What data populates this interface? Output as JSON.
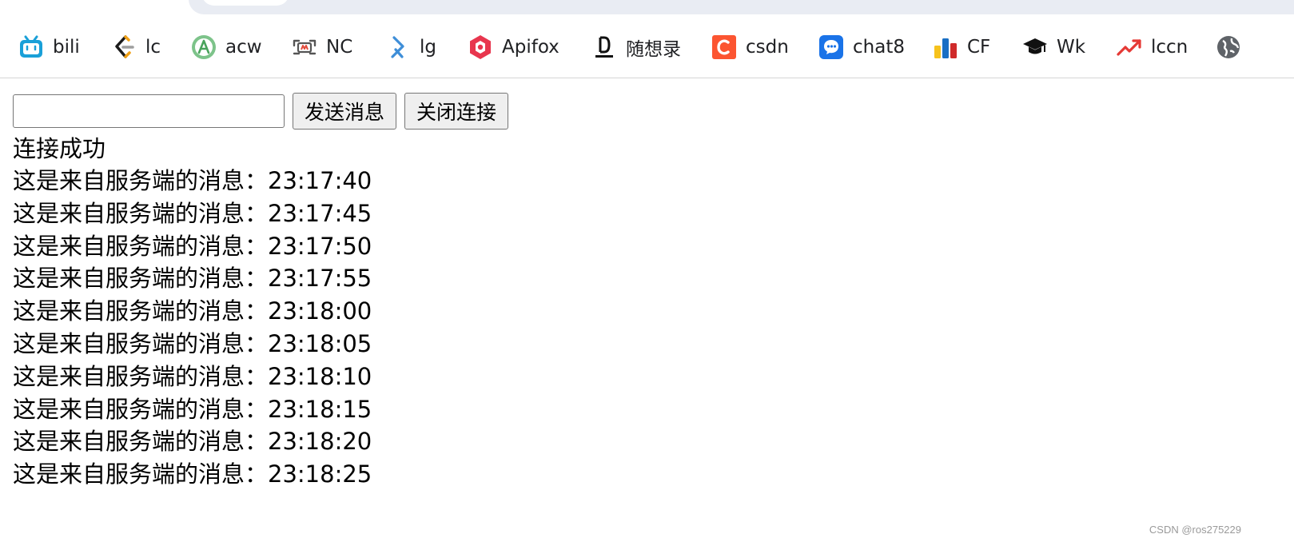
{
  "bookmarks": [
    {
      "label": "bili",
      "icon": "bilibili-icon"
    },
    {
      "label": "lc",
      "icon": "leetcode-icon"
    },
    {
      "label": "acw",
      "icon": "acwing-icon"
    },
    {
      "label": "NC",
      "icon": "nowcoder-icon"
    },
    {
      "label": "lg",
      "icon": "luogu-icon"
    },
    {
      "label": "Apifox",
      "icon": "apifox-icon"
    },
    {
      "label": "随想录",
      "icon": "daimasuixianglu-icon"
    },
    {
      "label": "csdn",
      "icon": "csdn-icon"
    },
    {
      "label": "chat8",
      "icon": "chat-bubble-icon"
    },
    {
      "label": "CF",
      "icon": "codeforces-icon"
    },
    {
      "label": "Wk",
      "icon": "graduation-cap-icon"
    },
    {
      "label": "lccn",
      "icon": "trending-up-icon"
    },
    {
      "label": "",
      "icon": "globe-icon"
    }
  ],
  "controls": {
    "input_value": "",
    "send_label": "发送消息",
    "close_label": "关闭连接"
  },
  "status": "连接成功",
  "messages": [
    "这是来自服务端的消息：23:17:40",
    "这是来自服务端的消息：23:17:45",
    "这是来自服务端的消息：23:17:50",
    "这是来自服务端的消息：23:17:55",
    "这是来自服务端的消息：23:18:00",
    "这是来自服务端的消息：23:18:05",
    "这是来自服务端的消息：23:18:10",
    "这是来自服务端的消息：23:18:15",
    "这是来自服务端的消息：23:18:20",
    "这是来自服务端的消息：23:18:25"
  ],
  "watermark": "CSDN @ros275229",
  "colors": {
    "bilibili": "#1aa0d8",
    "apifox": "#e8364e",
    "csdn": "#fc5531",
    "chat8": "#1a73e8",
    "lccn": "#e53935"
  }
}
